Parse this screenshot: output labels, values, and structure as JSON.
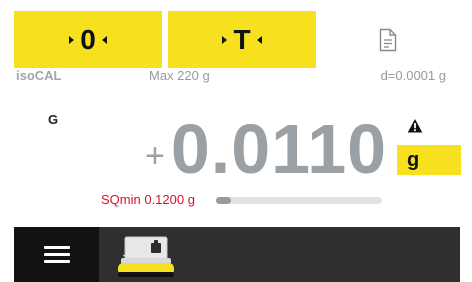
{
  "topbar": {
    "zero_label": "0",
    "tare_label": "T",
    "doc_icon": "document-icon"
  },
  "info": {
    "program": "isoCAL",
    "max": "Max 220 g",
    "readability": "d=0.0001 g"
  },
  "weight": {
    "gross_label": "G",
    "sign": "+",
    "value": "0.0110",
    "unit": "g",
    "warning_icon": "warning-icon"
  },
  "sqmin": {
    "text": "SQmin 0.1200 g",
    "progress_fraction": 0.09
  },
  "bottombar": {
    "menu_icon": "hamburger-menu-icon",
    "app_icon": "balance-weighing-icon"
  },
  "colors": {
    "accent": "#f7e01e",
    "weight_text": "#9aa0a4",
    "sqmin_red": "#d8102d",
    "bottom_bar": "#2f2f2f"
  }
}
